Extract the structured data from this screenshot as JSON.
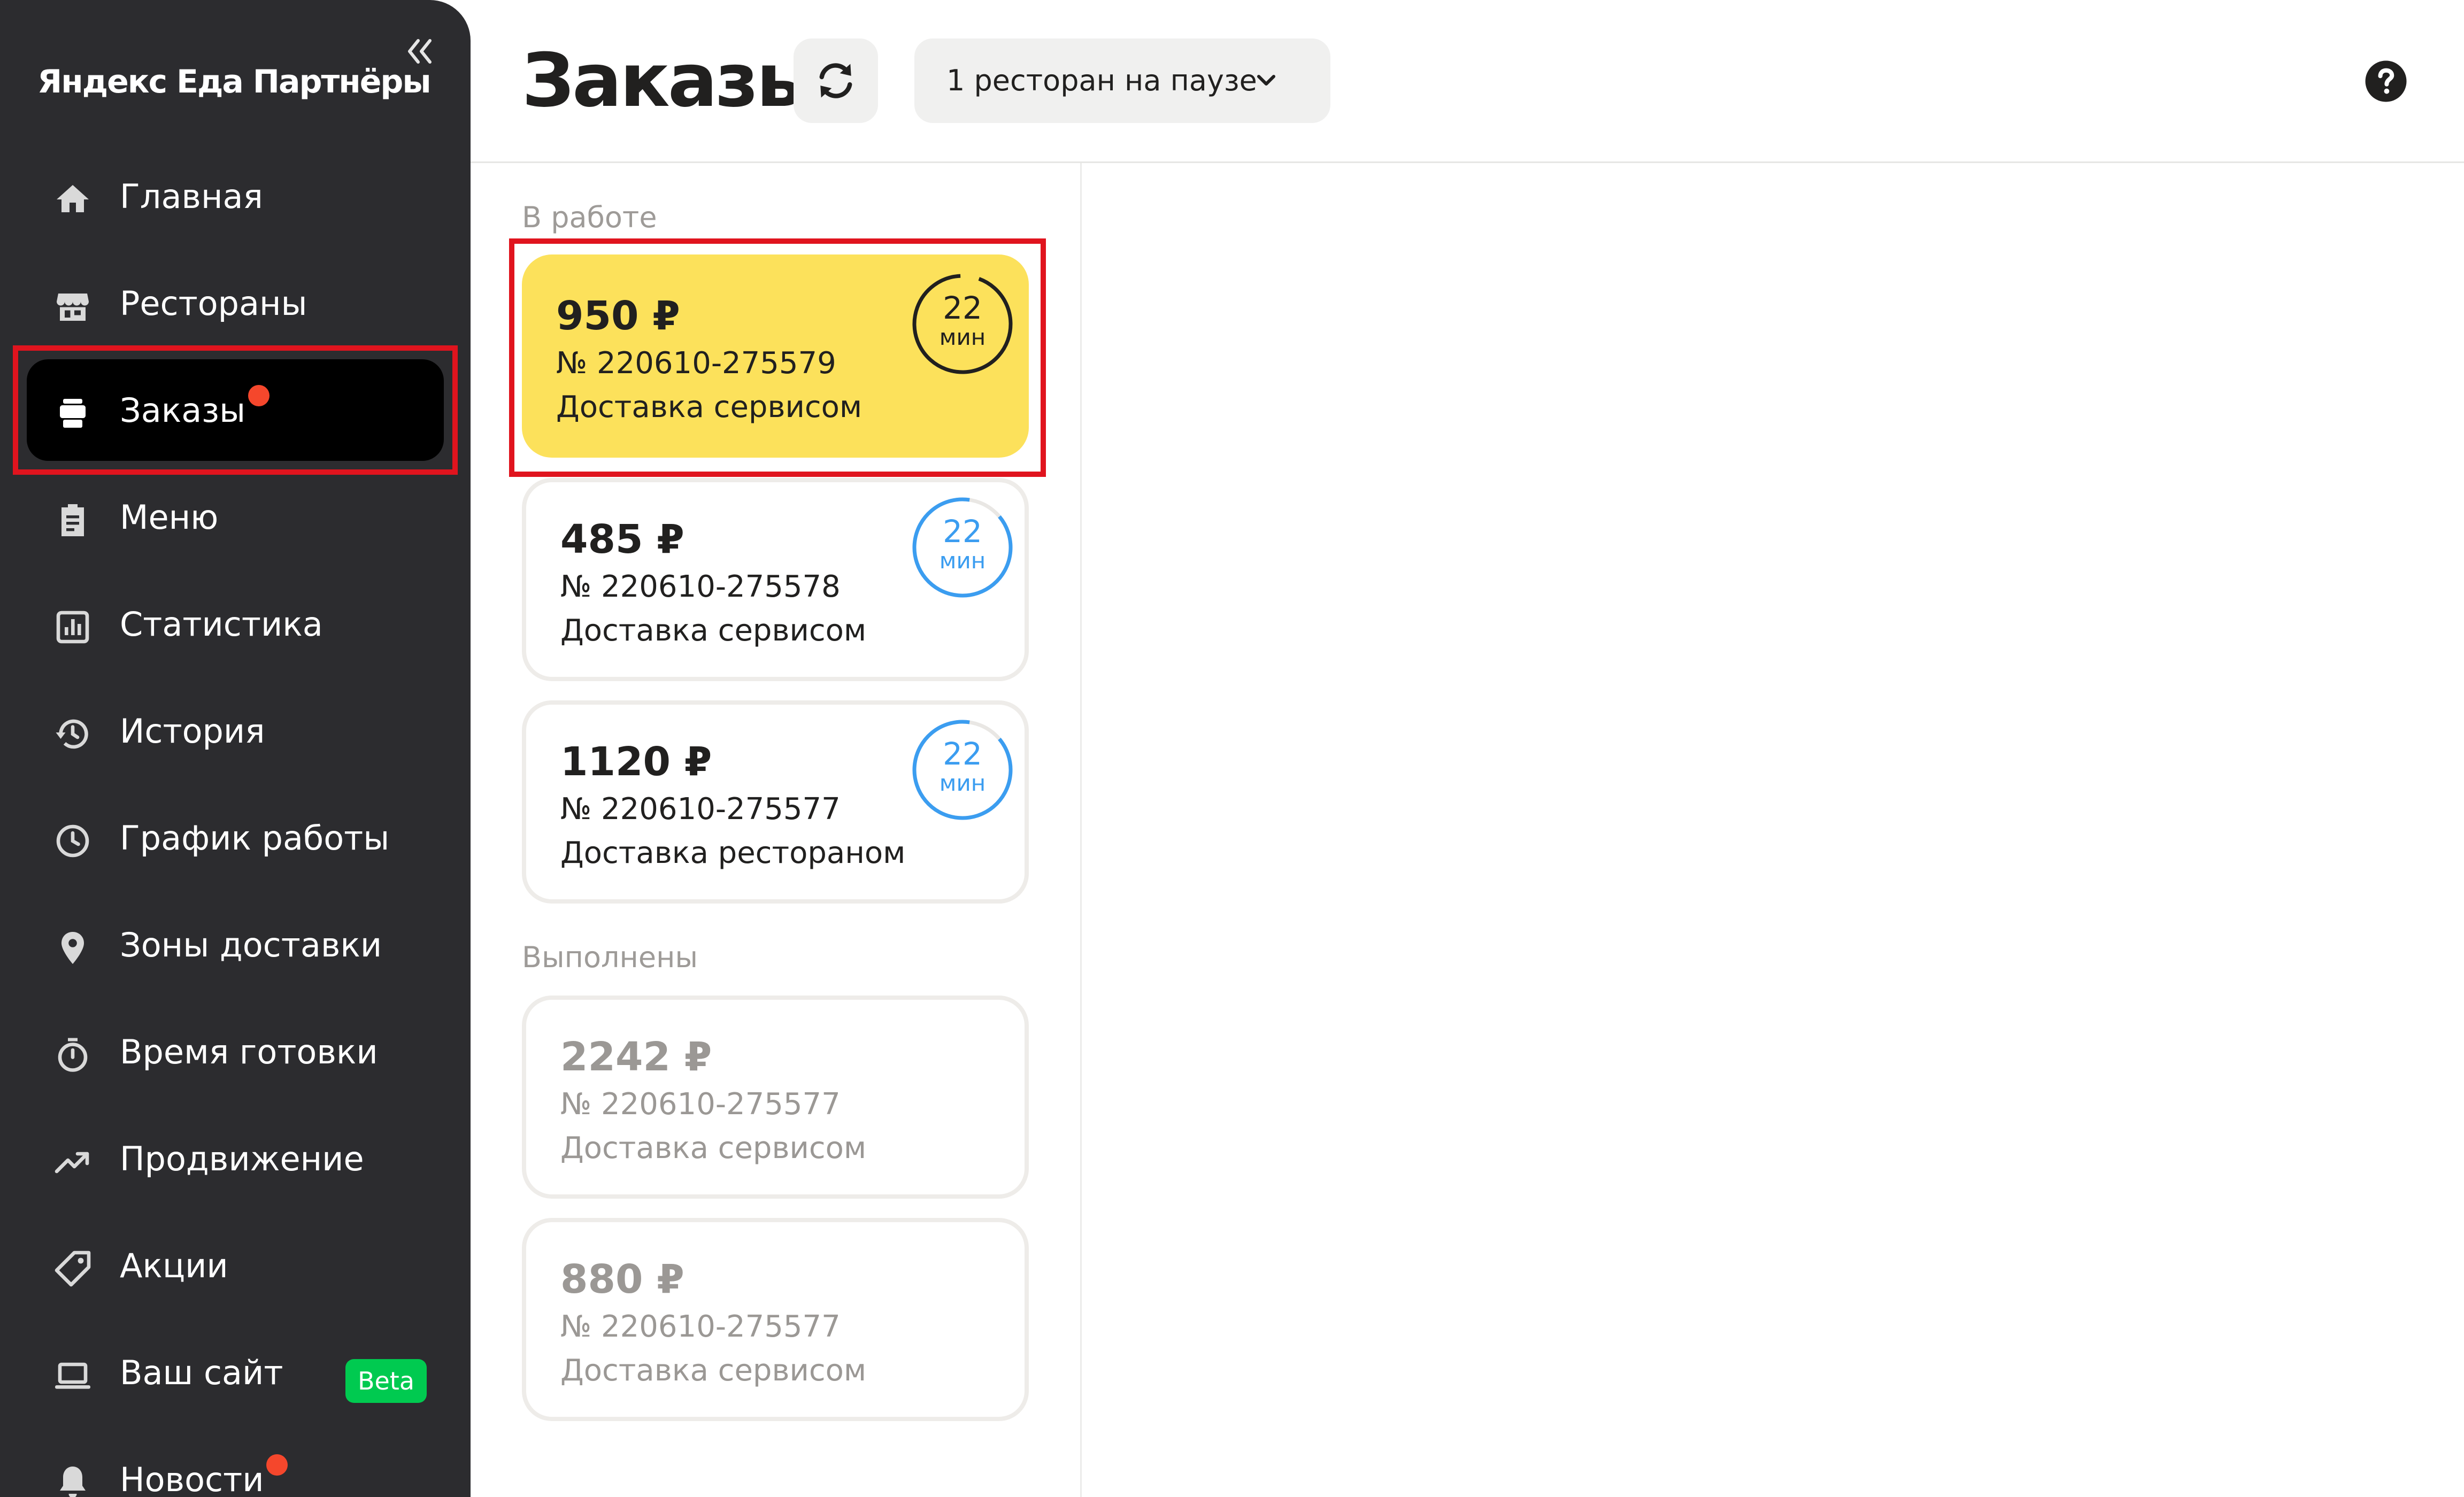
{
  "sidebar": {
    "brand": "Яндекс Еда Партнёры",
    "items": [
      {
        "label": "Главная",
        "icon": "home-icon"
      },
      {
        "label": "Рестораны",
        "icon": "store-icon"
      },
      {
        "label": "Заказы",
        "icon": "orders-icon",
        "active": true,
        "notification": true
      },
      {
        "label": "Меню",
        "icon": "clipboard-icon"
      },
      {
        "label": "Статистика",
        "icon": "chart-icon"
      },
      {
        "label": "История",
        "icon": "history-icon"
      },
      {
        "label": "График работы",
        "icon": "clock-icon"
      },
      {
        "label": "Зоны доставки",
        "icon": "location-pin-icon"
      },
      {
        "label": "Время готовки",
        "icon": "stopwatch-icon"
      },
      {
        "label": "Продвижение",
        "icon": "trending-up-icon"
      },
      {
        "label": "Акции",
        "icon": "tag-icon"
      },
      {
        "label": "Ваш сайт",
        "icon": "laptop-icon",
        "badge": "Beta"
      },
      {
        "label": "Новости",
        "icon": "bell-icon",
        "notification": true
      }
    ]
  },
  "header": {
    "title": "Заказы",
    "pause_dropdown": "1 ресторан на паузе"
  },
  "sections": {
    "in_progress": "В работе",
    "completed": "Выполнены"
  },
  "orders_in_progress": [
    {
      "price": "950 ₽",
      "number": "№ 220610-275579",
      "delivery": "Доставка сервисом",
      "timer_value": "22",
      "timer_unit": "мин",
      "selected": true
    },
    {
      "price": "485 ₽",
      "number": "№ 220610-275578",
      "delivery": "Доставка сервисом",
      "timer_value": "22",
      "timer_unit": "мин"
    },
    {
      "price": "1120 ₽",
      "number": "№ 220610-275577",
      "delivery": "Доставка рестораном",
      "timer_value": "22",
      "timer_unit": "мин"
    }
  ],
  "orders_completed": [
    {
      "price": "2242 ₽",
      "number": "№ 220610-275577",
      "delivery": "Доставка сервисом"
    },
    {
      "price": "880 ₽",
      "number": "№ 220610-275577",
      "delivery": "Доставка сервисом"
    }
  ],
  "colors": {
    "sidebar_bg": "#2c2c2f",
    "active_bg": "#000000",
    "selected_card": "#fce15b",
    "timer_blue": "#3b9df0",
    "highlight_red": "#e0141e",
    "notification_dot": "#f5472c",
    "beta_badge": "#00ca50"
  }
}
